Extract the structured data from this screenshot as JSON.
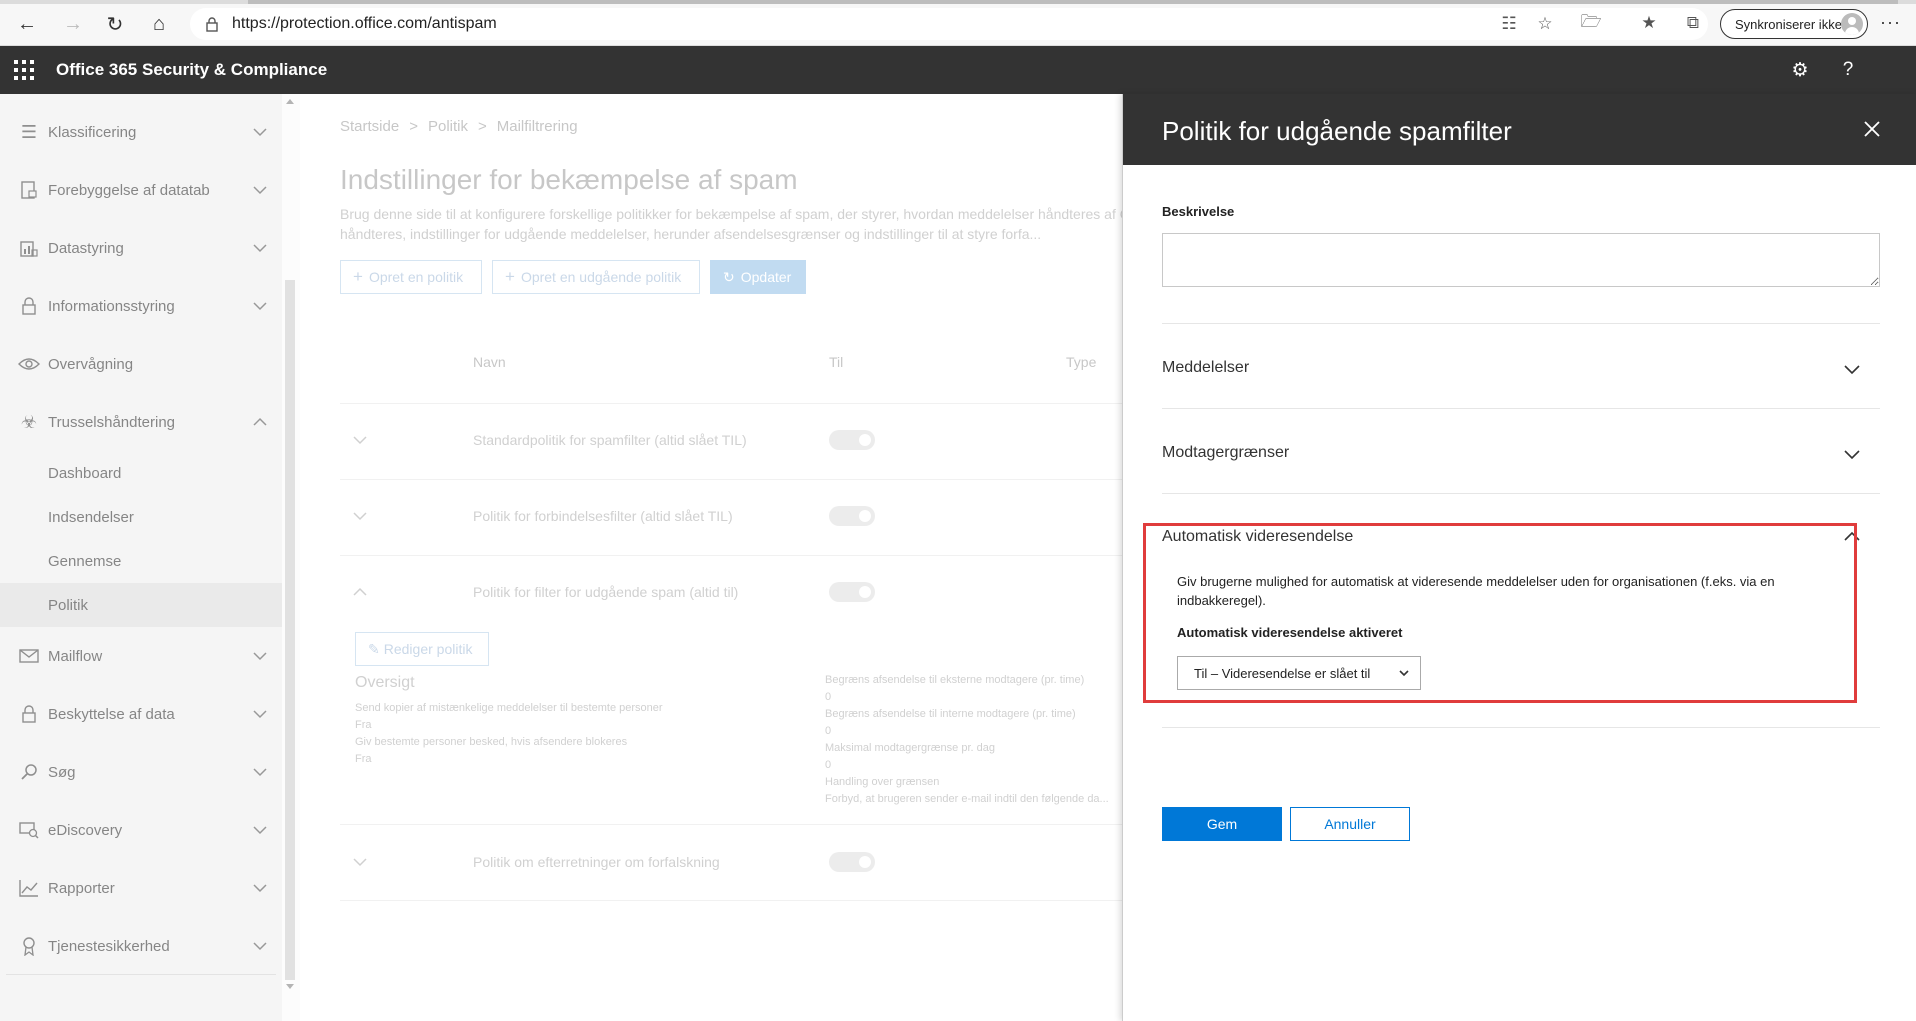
{
  "browser": {
    "url": "https://protection.office.com/antispam",
    "sync_label": "Synkroniserer ikke"
  },
  "app": {
    "title": "Office 365 Security & Compliance"
  },
  "sidebar": {
    "items": [
      {
        "label": "Klassificering",
        "icon": "list-icon"
      },
      {
        "label": "Forebyggelse af datatab",
        "icon": "document-lock-icon"
      },
      {
        "label": "Datastyring",
        "icon": "chart-document-icon"
      },
      {
        "label": "Informationsstyring",
        "icon": "lock-icon"
      },
      {
        "label": "Overvågning",
        "icon": "eye-icon"
      },
      {
        "label": "Trusselshåndtering",
        "icon": "biohazard-icon"
      }
    ],
    "subitems": [
      "Dashboard",
      "Indsendelser",
      "Gennemse",
      "Politik"
    ],
    "items2": [
      {
        "label": "Mailflow",
        "icon": "mail-icon"
      },
      {
        "label": "Beskyttelse af data",
        "icon": "lock-icon"
      },
      {
        "label": "Søg",
        "icon": "search-icon"
      },
      {
        "label": "eDiscovery",
        "icon": "ediscovery-icon"
      },
      {
        "label": "Rapporter",
        "icon": "trend-chart-icon"
      },
      {
        "label": "Tjenestesikkerhed",
        "icon": "ribbon-icon"
      }
    ]
  },
  "main": {
    "breadcrumb": [
      "Startside",
      ">",
      "Politik",
      ">",
      "Mailfiltrering"
    ],
    "title": "Indstillinger for bekæmpelse af spam",
    "description": "Brug denne side til at konfigurere forskellige politikker for bekæmpelse af spam, der styrer, hvordan meddelelser håndteres af O... eller phishing, håndteres, indstillinger for udgående meddelelser, herunder afsendelsesgrænser og indstillinger til at styre forfa...",
    "buttons": {
      "create": "Opret en politik",
      "create_outbound": "Opret en udgående politik",
      "refresh": "Opdater"
    },
    "columns": {
      "name": "Navn",
      "to": "Til",
      "type": "Type"
    },
    "rows": [
      "Standardpolitik for spamfilter (altid slået TIL)",
      "Politik for forbindelsesfilter (altid slået TIL)",
      "Politik for filter for udgående spam (altid til)",
      "Politik om efterretninger om forfalskning"
    ],
    "edit_policy": "Rediger politik",
    "overview": {
      "title": "Oversigt",
      "left": [
        "Send kopier af mistænkelige meddelelser til bestemte personer",
        "Fra",
        "Giv bestemte personer besked, hvis afsendere blokeres",
        "Fra"
      ],
      "right": [
        "Begræns afsendelse til eksterne modtagere (pr. time)",
        "0",
        "Begræns afsendelse til interne modtagere (pr. time)",
        "0",
        "Maksimal modtagergrænse pr. dag",
        "0",
        "Handling over grænsen",
        "Forbyd, at brugeren sender e-mail indtil den følgende da..."
      ]
    }
  },
  "panel": {
    "title": "Politik for udgående spamfilter",
    "description_label": "Beskrivelse",
    "description_value": "",
    "sections": {
      "messages": "Meddelelser",
      "recipient_limits": "Modtagergrænser",
      "auto_forward": "Automatisk videresendelse"
    },
    "auto_forward_text": "Giv brugerne mulighed for automatisk at videresende meddelelser uden for organisationen (f.eks. via en indbakkeregel).",
    "auto_forward_enabled_label": "Automatisk videresendelse aktiveret",
    "auto_forward_selected": "Til – Videresendelse er slået til",
    "save": "Gem",
    "cancel": "Annuller"
  },
  "colors": {
    "accent": "#0078d7",
    "header": "#333333",
    "highlight": "#e03c3c"
  }
}
